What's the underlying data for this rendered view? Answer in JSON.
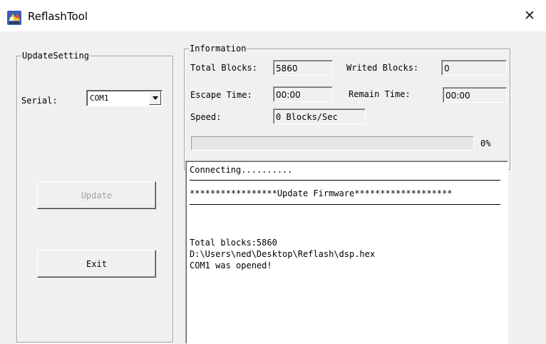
{
  "window": {
    "title": "ReflashTool",
    "icon": "reflash-app-icon",
    "close_glyph": "✕"
  },
  "update_setting": {
    "group_label": "UpdateSetting",
    "serial_label": "Serial:",
    "serial_value": "COM1",
    "update_button": "Update",
    "exit_button": "Exit"
  },
  "information": {
    "group_label": "Information",
    "total_blocks_label": "Total Blocks:",
    "total_blocks_value": "5860",
    "writed_blocks_label": "Writed Blocks:",
    "writed_blocks_value": "0",
    "escape_time_label": "Escape Time:",
    "escape_time_value": "00:00",
    "remain_time_label": "Remain Time:",
    "remain_time_value": "00:00",
    "speed_label": "Speed:",
    "speed_value": "0 Blocks/Sec",
    "progress_text": "0%",
    "progress_fraction": 0
  },
  "log": {
    "lines": [
      "Connecting..........",
      "*****************Update Firmware*******************",
      "Total blocks:5860",
      "D:\\Users\\ned\\Desktop\\Reflash\\dsp.hex",
      "COM1 was opened!"
    ]
  },
  "colors": {
    "window_bg": "#f0f0f0",
    "titlebar_bg": "#ffffff",
    "progress_fill": "#06b025",
    "disabled_text": "#a0a0a0"
  }
}
